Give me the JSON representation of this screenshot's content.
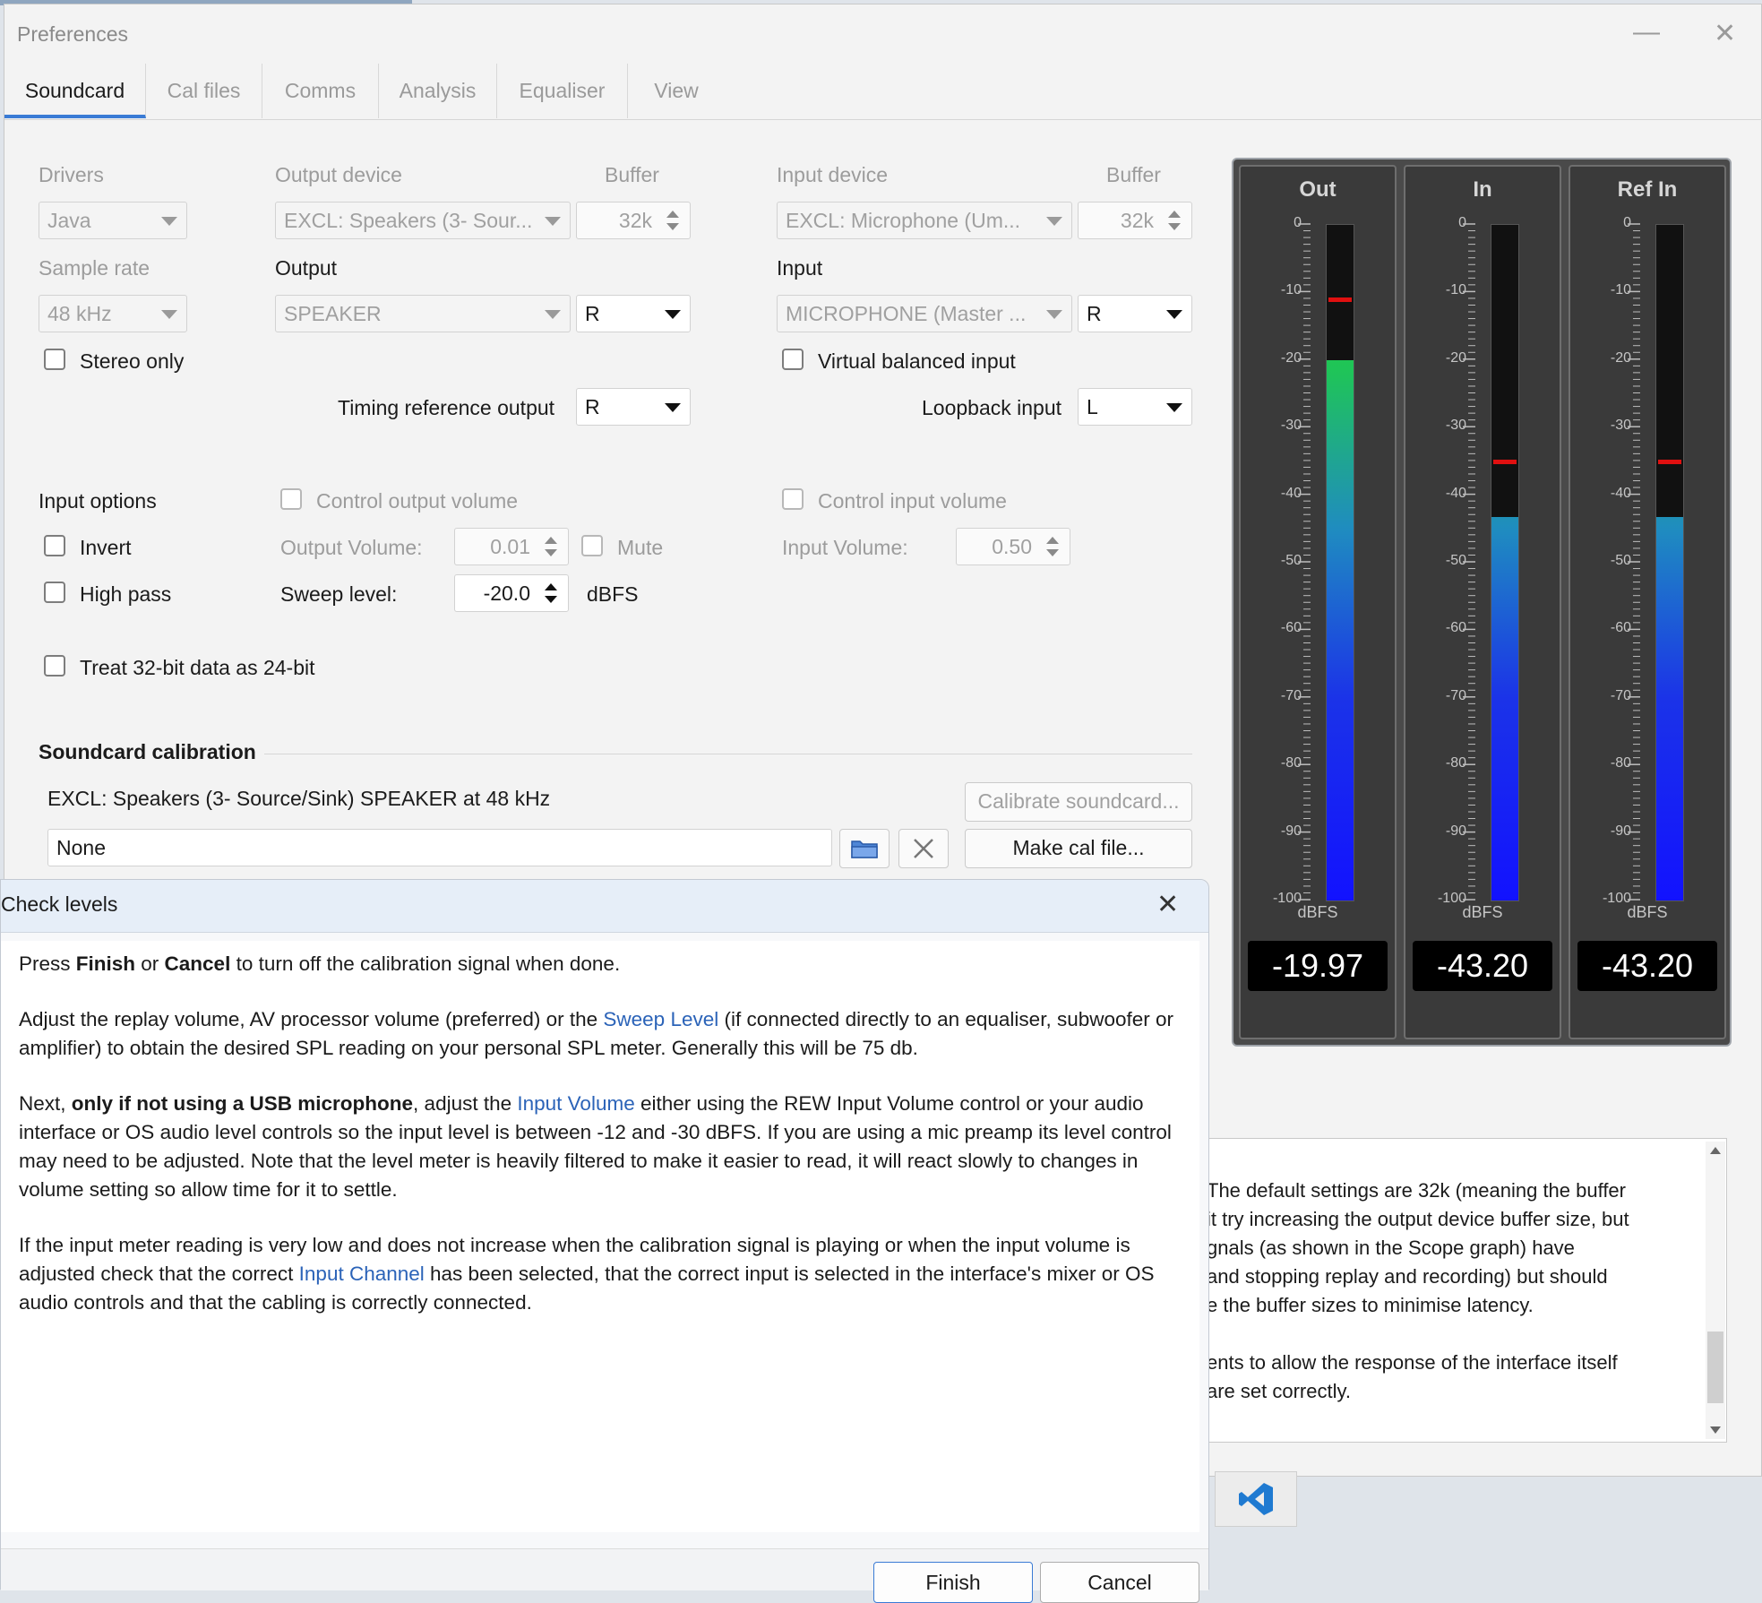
{
  "window": {
    "title": "Preferences",
    "minimize_glyph": "—",
    "close_glyph": "✕"
  },
  "tabs": [
    {
      "label": "Soundcard",
      "active": true
    },
    {
      "label": "Cal files"
    },
    {
      "label": "Comms"
    },
    {
      "label": "Analysis"
    },
    {
      "label": "Equaliser"
    },
    {
      "label": "View"
    }
  ],
  "soundcard": {
    "drivers_label": "Drivers",
    "drivers_value": "Java",
    "output_device_label": "Output device",
    "output_device_value": "EXCL: Speakers (3- Sour...",
    "output_buffer_label": "Buffer",
    "output_buffer_value": "32k",
    "input_device_label": "Input device",
    "input_device_value": "EXCL: Microphone (Um...",
    "input_buffer_label": "Buffer",
    "input_buffer_value": "32k",
    "sample_rate_label": "Sample rate",
    "sample_rate_value": "48 kHz",
    "output_label": "Output",
    "output_value": "SPEAKER",
    "output_channel": "R",
    "input_label": "Input",
    "input_value": "MICROPHONE (Master ...",
    "input_channel": "R",
    "stereo_only_label": "Stereo only",
    "virtual_balanced_label": "Virtual balanced input",
    "timing_ref_label": "Timing reference output",
    "timing_ref_value": "R",
    "loopback_label": "Loopback input",
    "loopback_value": "L",
    "input_options_label": "Input options",
    "control_output_volume_label": "Control output volume",
    "control_input_volume_label": "Control input volume",
    "invert_label": "Invert",
    "output_volume_label": "Output Volume:",
    "output_volume_value": "0.01",
    "mute_label": "Mute",
    "input_volume_label": "Input Volume:",
    "input_volume_value": "0.50",
    "high_pass_label": "High pass",
    "sweep_level_label": "Sweep level:",
    "sweep_level_value": "-20.0",
    "sweep_unit": "dBFS",
    "treat_32bit_label": "Treat 32-bit data as 24-bit",
    "calibration_heading": "Soundcard calibration",
    "calibration_device": "EXCL: Speakers (3- Source/Sink) SPEAKER at 48 kHz",
    "calibrate_button": "Calibrate soundcard...",
    "cal_file_value": "None",
    "make_cal_button": "Make cal file..."
  },
  "meters": {
    "scale_labels": [
      "0",
      "-10",
      "-20",
      "-30",
      "-40",
      "-50",
      "-60",
      "-70",
      "-80",
      "-90",
      "-100"
    ],
    "unit": "dBFS",
    "items": [
      {
        "title": "Out",
        "reading": "-19.97",
        "level_db": -19.97,
        "peak_db": -11
      },
      {
        "title": "In",
        "reading": "-43.20",
        "level_db": -43.2,
        "peak_db": -35
      },
      {
        "title": "Ref In",
        "reading": "-43.20",
        "level_db": -43.2,
        "peak_db": -35
      }
    ]
  },
  "help_background": {
    "lines": [
      "The default settings are 32k (meaning the buffer",
      "it try increasing the output device buffer size, but",
      "gnals (as shown in the Scope graph) have",
      "and stopping replay and recording) but should",
      "e the buffer sizes to minimise latency.",
      "",
      "ents to allow the response of the interface itself",
      "are set correctly."
    ]
  },
  "dialog": {
    "title": "Check levels",
    "close_glyph": "✕",
    "p1": {
      "a": "Press ",
      "b": "Finish",
      "c": " or ",
      "d": "Cancel",
      "e": " to turn off the calibration signal when done."
    },
    "p2": {
      "a": "Adjust the replay volume, AV processor volume (preferred) or the ",
      "link": "Sweep Level",
      "b": " (if connected directly to an equaliser, subwoofer or amplifier) to obtain the desired SPL reading on your personal SPL meter. Generally this will be 75 db."
    },
    "p3": {
      "a": "Next, ",
      "bold": "only if not using a USB microphone",
      "b": ", adjust the ",
      "link": "Input Volume",
      "c": " either using the REW Input Volume control or your audio interface or OS audio level controls so the input level is between -12 and -30 dBFS. If you are using a mic preamp its level control may need to be adjusted. Note that the level meter is heavily filtered to make it easier to read, it will react slowly to changes in volume setting so allow time for it to settle."
    },
    "p4": {
      "a": "If the input meter reading is very low and does not increase when the calibration signal is playing or when the input volume is adjusted check that the correct ",
      "link": "Input Channel",
      "b": " has been selected, that the correct input is selected in the interface's mixer or OS audio controls and that the cabling is correctly connected."
    },
    "finish_button": "Finish",
    "cancel_button": "Cancel"
  },
  "colors": {
    "accent": "#3a7bd5",
    "link": "#2b63b8",
    "peak": "#e01010",
    "meter_green": "#22e022",
    "meter_blue": "#1212ff"
  }
}
